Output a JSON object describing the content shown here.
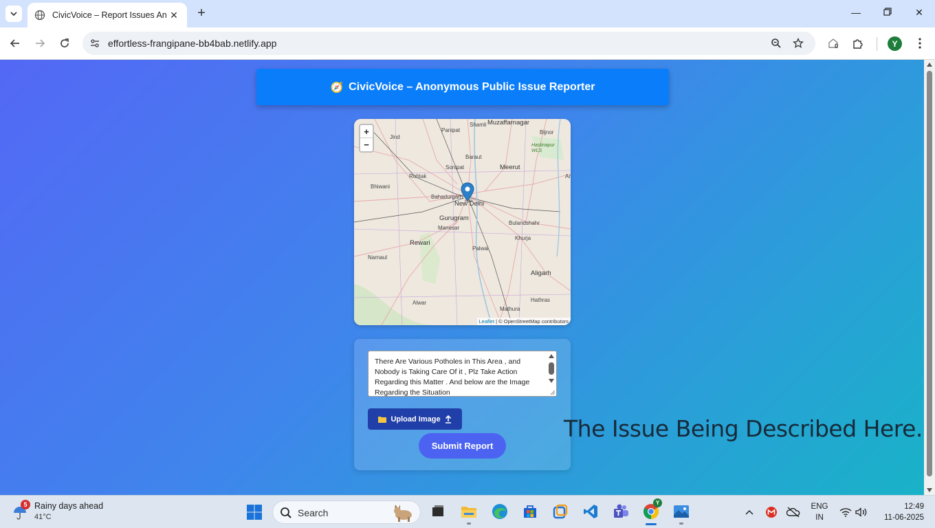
{
  "browser": {
    "tab_title": "CivicVoice – Report Issues Anonymously",
    "url": "effortless-frangipane-bb4bab.netlify.app",
    "extension_badge": "0",
    "profile_initial": "Y"
  },
  "page": {
    "header_emoji": "🧭",
    "header_title": "CivicVoice – Anonymous Public Issue Reporter",
    "map": {
      "zoom_in": "+",
      "zoom_out": "−",
      "attribution_leaflet": "Leaflet",
      "attribution_rest": "| © OpenStreetMap contributors",
      "places": [
        "Muzaffarnagar",
        "Panipat",
        "Shamli",
        "Bijnor",
        "Jind",
        "Hastinapur WLS",
        "Baraut",
        "Meerut",
        "Sonipat",
        "Bhiwani",
        "Rohtak",
        "Bahadurgarh",
        "New Delhi",
        "Gurugram",
        "Manesar",
        "Bulandshahr",
        "Rewari",
        "Palwal",
        "Khurja",
        "Narnaul",
        "Aligarh",
        "Alwar",
        "Hathras",
        "Mathura",
        "Ar"
      ]
    },
    "form": {
      "description": "There Are Various Potholes in This Area , and Nobody is Taking Care Of it , Plz Take Action Regarding this Matter . And below are the Image Regarding the Situation",
      "upload_label": "Upload Image",
      "submit_label": "Submit Report"
    },
    "caption": "The Issue Being Described Here."
  },
  "taskbar": {
    "weather_badge": "5",
    "weather_title": "Rainy days ahead",
    "weather_temp": "41°C",
    "search_label": "Search",
    "chrome_badge": "Y",
    "lang_line1": "ENG",
    "lang_line2": "IN",
    "time": "12:49",
    "date": "11-06-2025"
  },
  "colors": {
    "header_blue": "#0a7dfb",
    "upload_button": "#213fa8",
    "submit_button": "#4c63f2",
    "profile_green": "#1e7d3a"
  }
}
